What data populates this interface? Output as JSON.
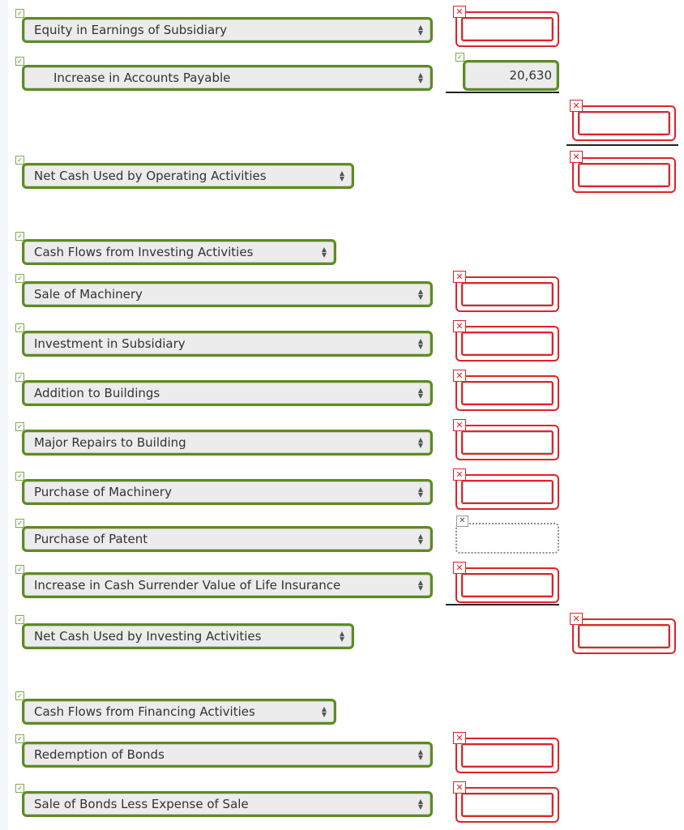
{
  "colors": {
    "correct_border": "#5c8c1e",
    "incorrect_border": "#e2222a",
    "field_bg": "#ececec"
  },
  "icons": {
    "check": "✓",
    "cross": "✕",
    "select_arrows": "▲▼"
  },
  "rows": [
    {
      "label": "Equity in Earnings of Subsidiary",
      "status": "correct",
      "answer": {
        "value": "",
        "status": "incorrect"
      }
    },
    {
      "label": "Increase in Accounts Payable",
      "status": "correct",
      "answer": {
        "value": "20,630",
        "status": "correct"
      }
    },
    {
      "label": "",
      "subtotal": {
        "value": "",
        "status": "incorrect"
      }
    },
    {
      "label": "Net Cash Used by Operating Activities",
      "status": "correct",
      "total": {
        "value": "",
        "status": "incorrect"
      }
    },
    {
      "label": "Cash Flows from Investing Activities",
      "status": "correct"
    },
    {
      "label": "Sale of Machinery",
      "status": "correct",
      "answer": {
        "value": "",
        "status": "incorrect"
      }
    },
    {
      "label": "Investment in Subsidiary",
      "status": "correct",
      "answer": {
        "value": "",
        "status": "incorrect"
      }
    },
    {
      "label": "Addition to Buildings",
      "status": "correct",
      "answer": {
        "value": "",
        "status": "incorrect"
      }
    },
    {
      "label": "Major Repairs to Building",
      "status": "correct",
      "answer": {
        "value": "",
        "status": "incorrect"
      }
    },
    {
      "label": "Purchase of Machinery",
      "status": "correct",
      "answer": {
        "value": "",
        "status": "incorrect"
      }
    },
    {
      "label": "Purchase of Patent",
      "status": "correct",
      "answer": {
        "value": "",
        "status": "unanswered"
      }
    },
    {
      "label": "Increase in Cash Surrender Value of Life Insurance",
      "status": "correct",
      "answer": {
        "value": "",
        "status": "incorrect"
      }
    },
    {
      "label": "Net Cash Used by Investing Activities",
      "status": "correct",
      "total": {
        "value": "",
        "status": "incorrect"
      }
    },
    {
      "label": "Cash Flows from Financing Activities",
      "status": "correct"
    },
    {
      "label": "Redemption of Bonds",
      "status": "correct",
      "answer": {
        "value": "",
        "status": "incorrect"
      }
    },
    {
      "label": "Sale of Bonds Less Expense of Sale",
      "status": "correct",
      "answer": {
        "value": "",
        "status": "incorrect"
      }
    }
  ]
}
